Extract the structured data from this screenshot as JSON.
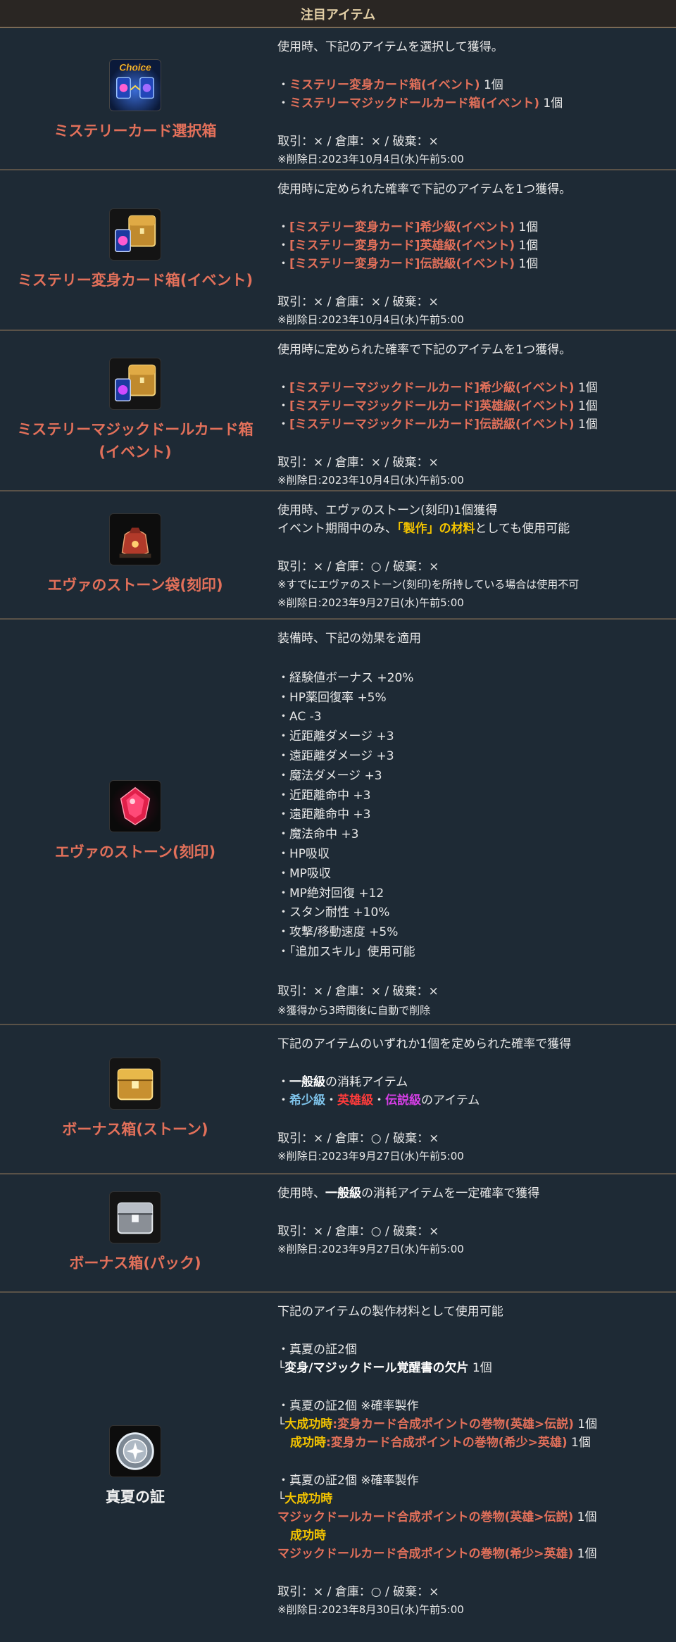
{
  "header": "注目アイテム",
  "items": [
    {
      "name": "ミステリーカード選択箱",
      "icon": "choice-box-icon",
      "desc": "使用時、下記のアイテムを選択して獲得。",
      "lines": [
        {
          "pre": "・",
          "hl": "ミステリー変身カード箱(イベント)",
          "post": " 1個"
        },
        {
          "pre": "・",
          "hl": "ミステリーマジックドールカード箱(イベント)",
          "post": " 1個"
        }
      ],
      "trade": "取引：× / 倉庫：× / 破棄：×",
      "note": "※削除日:2023年10月4日(水)午前5:00"
    },
    {
      "name": "ミステリー変身カード箱(イベント)",
      "icon": "transform-card-chest-icon",
      "desc": "使用時に定められた確率で下記のアイテムを1つ獲得。",
      "lines": [
        {
          "pre": "・",
          "hl": "[ミステリー変身カード]希少級(イベント)",
          "post": " 1個"
        },
        {
          "pre": "・",
          "hl": "[ミステリー変身カード]英雄級(イベント)",
          "post": " 1個"
        },
        {
          "pre": "・",
          "hl": "[ミステリー変身カード]伝説級(イベント)",
          "post": " 1個"
        }
      ],
      "trade": "取引：× / 倉庫：× / 破棄：×",
      "note": "※削除日:2023年10月4日(水)午前5:00"
    },
    {
      "name_l1": "ミステリーマジックドールカード箱",
      "name_l2": "(イベント)",
      "icon": "magic-doll-card-chest-icon",
      "desc": "使用時に定められた確率で下記のアイテムを1つ獲得。",
      "lines": [
        {
          "pre": "・",
          "hl": "[ミステリーマジックドールカード]希少級(イベント)",
          "post": " 1個"
        },
        {
          "pre": "・",
          "hl": "[ミステリーマジックドールカード]英雄級(イベント)",
          "post": " 1個"
        },
        {
          "pre": "・",
          "hl": "[ミステリーマジックドールカード]伝説級(イベント)",
          "post": " 1個"
        }
      ],
      "trade": "取引：× / 倉庫：× / 破棄：×",
      "note": "※削除日:2023年10月4日(水)午前5:00"
    },
    {
      "name": "エヴァのストーン袋(刻印)",
      "icon": "stone-pouch-icon",
      "desc1": "使用時、エヴァのストーン(刻印)1個獲得",
      "desc2_pre": "イベント期間中のみ、",
      "desc2_hl": "「製作」の材料",
      "desc2_post": "としても使用可能",
      "trade": "取引：× / 倉庫：○ / 破棄：×",
      "note1": "※すでにエヴァのストーン(刻印)を所持している場合は使用不可",
      "note2": "※削除日:2023年9月27日(水)午前5:00"
    },
    {
      "name": "エヴァのストーン(刻印)",
      "icon": "red-gem-icon",
      "desc": "装備時、下記の効果を適用",
      "effects": [
        "・経験値ボーナス +20%",
        "・HP薬回復率 +5%",
        "・AC -3",
        "・近距離ダメージ +3",
        "・遠距離ダメージ +3",
        "・魔法ダメージ +3",
        "・近距離命中 +3",
        "・遠距離命中 +3",
        "・魔法命中 +3",
        "・HP吸収",
        "・MP吸収",
        "・MP絶対回復 +12",
        "・スタン耐性 +10%",
        "・攻撃/移動速度 +5%",
        "・「追加スキル」使用可能"
      ],
      "trade": "取引：× / 倉庫：× / 破棄：×",
      "note": "※獲得から3時間後に自動で削除"
    },
    {
      "name": "ボーナス箱(ストーン)",
      "icon": "gold-chest-icon",
      "desc": "下記のアイテムのいずれか1個を定められた確率で獲得",
      "l1_pre": "・",
      "l1_hl": "一般級",
      "l1_post": "の消耗アイテム",
      "l2_pre": "・",
      "l2_a": "希少級",
      "l2_sep1": "・",
      "l2_b": "英雄級",
      "l2_sep2": "・",
      "l2_c": "伝説級",
      "l2_post": "のアイテム",
      "trade": "取引：× / 倉庫：○ / 破棄：×",
      "note": "※削除日:2023年9月27日(水)午前5:00"
    },
    {
      "name": "ボーナス箱(パック)",
      "icon": "silver-chest-icon",
      "desc_pre": "使用時、",
      "desc_hl": "一般級",
      "desc_post": "の消耗アイテムを一定確率で獲得",
      "trade": "取引：× / 倉庫：○ / 破棄：×",
      "note": "※削除日:2023年9月27日(水)午前5:00"
    },
    {
      "name": "真夏の証",
      "icon": "silver-medal-icon",
      "desc": "下記のアイテムの製作材料として使用可能",
      "a1": "・真夏の証2個",
      "a2_pre": "└",
      "a2_hl": "変身/マジックドール覚醒書の欠片",
      "a2_post": " 1個",
      "b1": "・真夏の証2個 ※確率製作",
      "b2_pre": "└",
      "b2_y": "大成功時",
      "b2_colon": ":",
      "b2_r": "変身カード合成ポイントの巻物(英雄>伝説)",
      "b2_post": " 1個",
      "b3_y": "成功時",
      "b3_colon": ":",
      "b3_r": "変身カード合成ポイントの巻物(希少>英雄)",
      "b3_post": " 1個",
      "c1": "・真夏の証2個 ※確率製作",
      "c2_pre": "└",
      "c2_y": "大成功時",
      "c3_r": "マジックドールカード合成ポイントの巻物(英雄>伝説)",
      "c3_post": " 1個",
      "c4_y": "成功時",
      "c5_r": "マジックドールカード合成ポイントの巻物(希少>英雄)",
      "c5_post": " 1個",
      "trade": "取引：× / 倉庫：○ / 破棄：×",
      "note": "※削除日:2023年8月30日(水)午前5:00"
    }
  ]
}
